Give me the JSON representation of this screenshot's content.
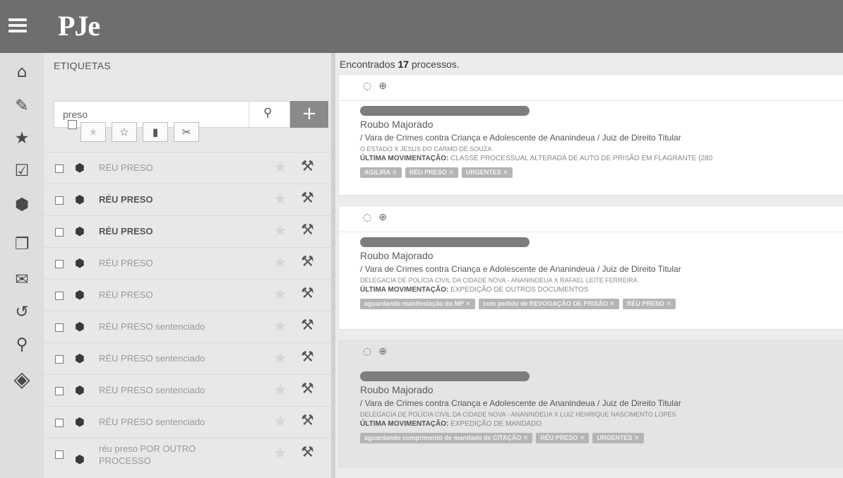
{
  "header": {
    "logo": "PJe"
  },
  "sidebar": {
    "icons": [
      "home-icon",
      "pencil-icon",
      "star-icon",
      "check-square-icon",
      "tags-icon",
      "copy-icon",
      "envelope-icon",
      "history-icon",
      "search-icon",
      "diamond-icon"
    ]
  },
  "tags_panel": {
    "title": "ETIQUETAS",
    "search_value": "preso",
    "add_label": "+",
    "tags": [
      {
        "label": "RÉU PRESO"
      },
      {
        "label": "RÉU PRESO"
      },
      {
        "label": "RÉU PRESO"
      },
      {
        "label": "RÉU PRESO"
      },
      {
        "label": "RÉU PRESO"
      },
      {
        "label": "RÉU PRESO sentenciado"
      },
      {
        "label": "RÉU PRESO sentenciado"
      },
      {
        "label": "RÉU PRESO sentenciado"
      },
      {
        "label": "RÉU PRESO sentenciado"
      },
      {
        "label": "réu preso POR OUTRO PROCESSO"
      }
    ]
  },
  "results": {
    "found_prefix": "Encontrados ",
    "found_count": "17",
    "found_suffix": " processos.",
    "cards": [
      {
        "classe": "Roubo Majorado",
        "orgao": "/ Vara de Crimes contra Criança e Adolescente de Ananindeua / Juiz de Direito Titular",
        "partes": "O ESTADO X JESUS DO CARMO DE SOUZA",
        "mov_label": "ÚLTIMA MOVIMENTAÇÃO:",
        "mov_text": "CLASSE PROCESSUAL ALTERADA DE AUTO DE PRISÃO EM FLAGRANTE (280",
        "chips": [
          "AGILIRA ✕",
          "RÉU PRESO ✕",
          "URGENTES ✕"
        ]
      },
      {
        "classe": "Roubo Majorado",
        "orgao": "/ Vara de Crimes contra Criança e Adolescente de Ananindeua / Juiz de Direito Titular",
        "partes": "DELEGACIA DE POLÍCIA CIVIL DA CIDADE NOVA - ANANINDEUA X RAFAEL LEITE FERREIRA",
        "mov_label": "ÚLTIMA MOVIMENTAÇÃO:",
        "mov_text": "EXPEDIÇÃO DE OUTROS DOCUMENTOS",
        "chips": [
          "aguardando manifestação do MP ✕",
          "com pedido de REVOGAÇÃO DE PRISÃO ✕",
          "RÉU PRESO ✕"
        ]
      },
      {
        "classe": "Roubo Majorado",
        "orgao": "/ Vara de Crimes contra Criança e Adolescente de Ananindeua / Juiz de Direito Titular",
        "partes": "DELEGACIA DE POLÍCIA CIVIL DA CIDADE NOVA - ANANINDEUA X LUIZ HENRIQUE NASCIMENTO LOPES",
        "mov_label": "ÚLTIMA MOVIMENTAÇÃO:",
        "mov_text": "EXPEDIÇÃO DE MANDADO",
        "chips": [
          "aguardando cumprimento de mandado de CITAÇÃO ✕",
          "RÉU PRESO ✕",
          "URGENTES ✕"
        ]
      }
    ]
  }
}
